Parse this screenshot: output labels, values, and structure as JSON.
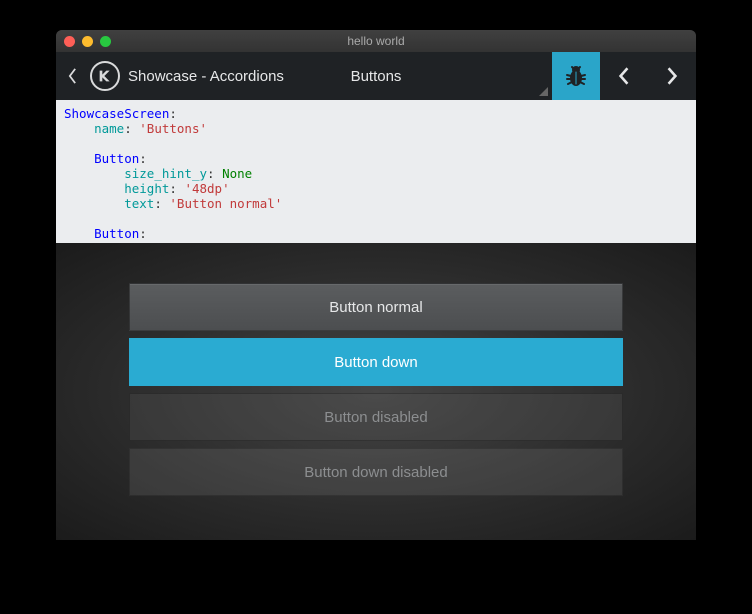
{
  "window": {
    "title": "hello world"
  },
  "toolbar": {
    "title": "Showcase - Accordions",
    "center": "Buttons"
  },
  "code": {
    "line1_kw": "ShowcaseScreen",
    "line2_key": "name",
    "line2_val": "'Buttons'",
    "line3_kw": "Button",
    "line4_key": "size_hint_y",
    "line4_val": "None",
    "line5_key": "height",
    "line5_val": "'48dp'",
    "line6_key": "text",
    "line6_val": "'Button normal'",
    "line7_kw": "Button"
  },
  "buttons": {
    "normal": "Button normal",
    "down": "Button down",
    "disabled": "Button disabled",
    "down_disabled": "Button down disabled"
  },
  "colors": {
    "accent": "#2aabd2"
  }
}
